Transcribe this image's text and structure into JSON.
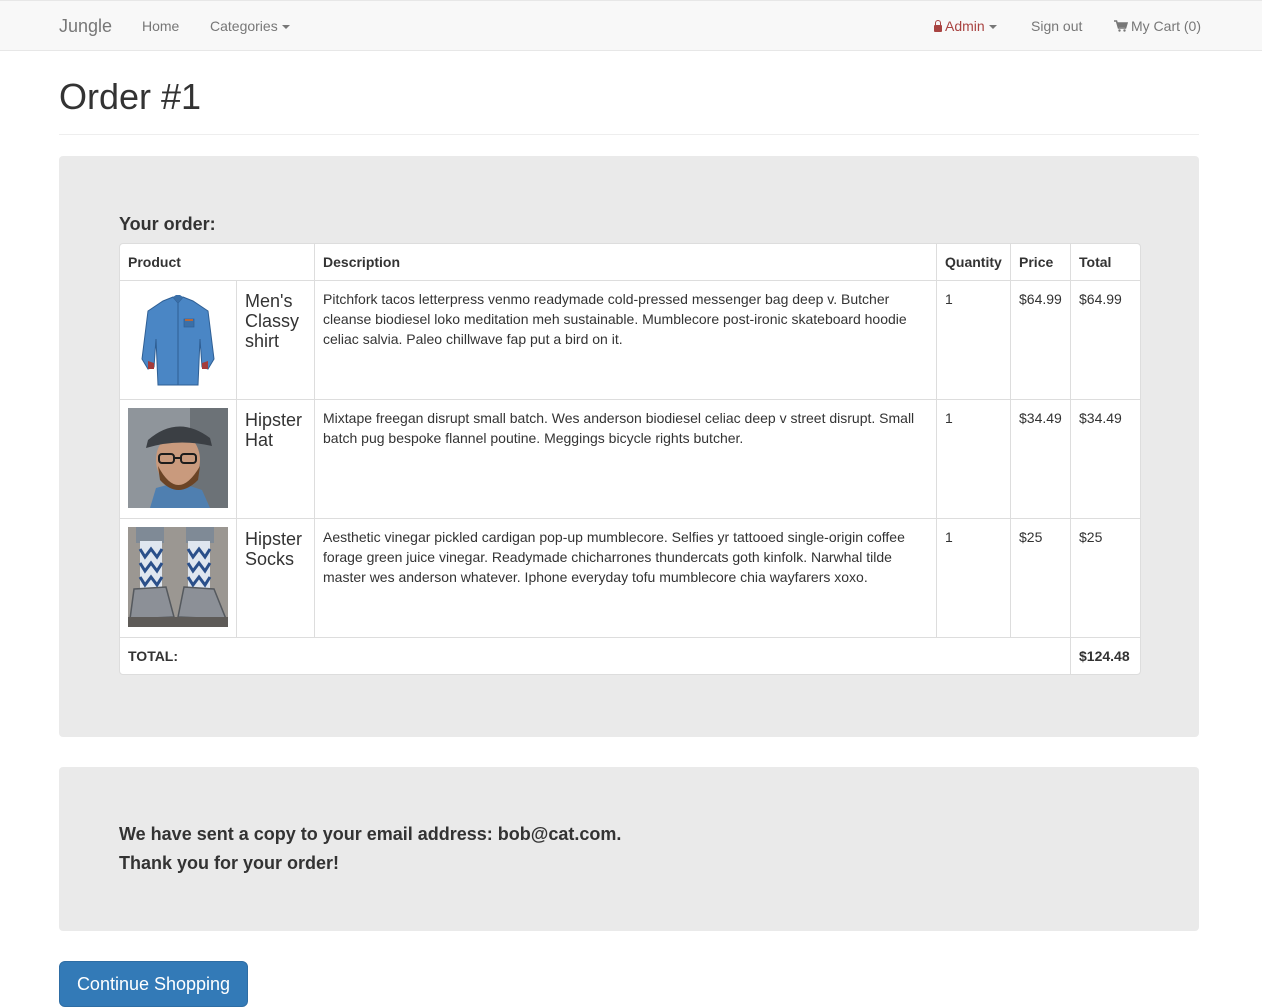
{
  "navbar": {
    "brand": "Jungle",
    "home": "Home",
    "categories": "Categories",
    "admin": "Admin",
    "sign_out": "Sign out",
    "cart": "My Cart (0)"
  },
  "page": {
    "title": "Order #1"
  },
  "order": {
    "heading": "Your order:",
    "columns": {
      "product": "Product",
      "description": "Description",
      "quantity": "Quantity",
      "price": "Price",
      "total": "Total"
    },
    "items": [
      {
        "name": "Men's Classy shirt",
        "image": "blue-denim-shirt",
        "description": "Pitchfork tacos letterpress venmo readymade cold-pressed messenger bag deep v. Butcher cleanse biodiesel loko meditation meh sustainable. Mumblecore post-ironic skateboard hoodie celiac salvia. Paleo chillwave fap put a bird on it.",
        "quantity": "1",
        "price": "$64.99",
        "total": "$64.99"
      },
      {
        "name": "Hipster Hat",
        "image": "man-in-flat-cap",
        "description": "Mixtape freegan disrupt small batch. Wes anderson biodiesel celiac deep v street disrupt. Small batch pug bespoke flannel poutine. Meggings bicycle rights butcher.",
        "quantity": "1",
        "price": "$34.49",
        "total": "$34.49"
      },
      {
        "name": "Hipster Socks",
        "image": "patterned-socks-and-sneakers",
        "description": "Aesthetic vinegar pickled cardigan pop-up mumblecore. Selfies yr tattooed single-origin coffee forage green juice vinegar. Readymade chicharrones thundercats goth kinfolk. Narwhal tilde master wes anderson whatever. Iphone everyday tofu mumblecore chia wayfarers xoxo.",
        "quantity": "1",
        "price": "$25",
        "total": "$25"
      }
    ],
    "total_label": "TOTAL:",
    "grand_total": "$124.48"
  },
  "confirmation": {
    "email_line": "We have sent a copy to your email address: bob@cat.com.",
    "thanks_line": "Thank you for your order!"
  },
  "actions": {
    "continue_label": "Continue Shopping"
  },
  "colors": {
    "navbar_bg": "#f8f8f8",
    "well_bg": "#eaeaea",
    "admin": "#a94442",
    "primary": "#337ab7"
  }
}
